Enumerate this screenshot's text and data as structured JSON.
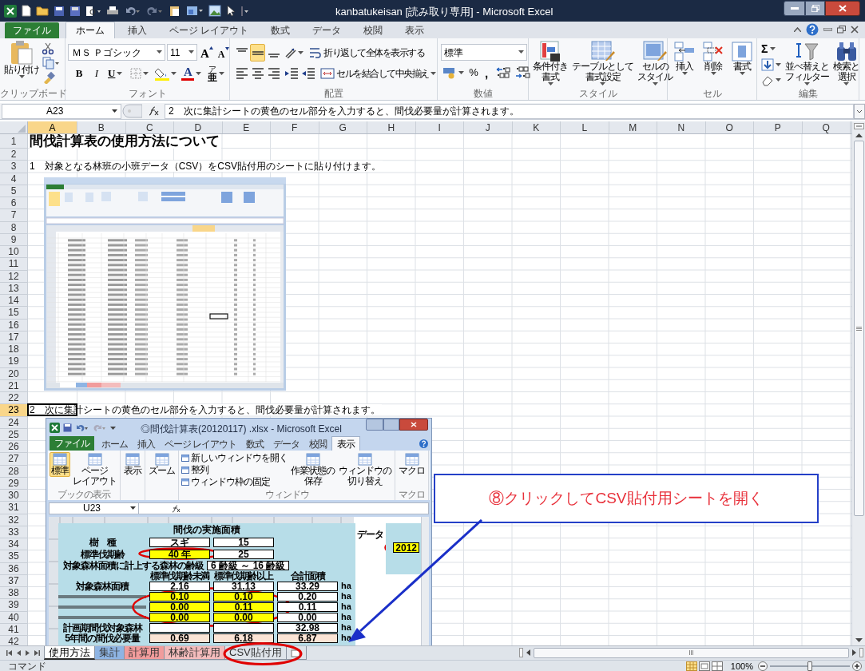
{
  "window": {
    "title": "kanbatukeisan  [読み取り専用] - Microsoft Excel"
  },
  "ribbon_tabs": [
    {
      "label": "ファイル",
      "kind": "file",
      "selected": false
    },
    {
      "label": "ホーム",
      "kind": "tab",
      "selected": true
    },
    {
      "label": "挿入",
      "kind": "tab",
      "selected": false
    },
    {
      "label": "ページ レイアウト",
      "kind": "tab",
      "selected": false
    },
    {
      "label": "数式",
      "kind": "tab",
      "selected": false
    },
    {
      "label": "データ",
      "kind": "tab",
      "selected": false
    },
    {
      "label": "校閲",
      "kind": "tab",
      "selected": false
    },
    {
      "label": "表示",
      "kind": "tab",
      "selected": false
    }
  ],
  "ribbon": {
    "clipboard": {
      "paste": "貼り付け",
      "label": "クリップボード"
    },
    "font": {
      "name": "ＭＳ Ｐゴシック",
      "size": "11",
      "grow": "A",
      "shrink": "A",
      "bold": "B",
      "italic": "I",
      "underline": "U",
      "font_color": "A",
      "phonetic_ruby": "ア",
      "phonetic": "亜",
      "label": "フォント"
    },
    "alignment": {
      "vertical": [
        {
          "selected": false
        },
        {
          "selected": true
        },
        {
          "selected": false
        }
      ],
      "wrap": "折り返して全体を表示する",
      "merge": "セルを結合して中央揃え",
      "label": "配置"
    },
    "number": {
      "format": "標準",
      "percent": "%",
      "comma": ",",
      "label": "数値"
    },
    "styles": {
      "items": [
        {
          "lines": [
            "条件付き",
            "書式"
          ]
        },
        {
          "lines": [
            "テーブルとして",
            "書式設定"
          ]
        },
        {
          "lines": [
            "セルの",
            "スタイル"
          ]
        }
      ],
      "label": "スタイル"
    },
    "cells": {
      "items": [
        "挿入",
        "削除",
        "書式"
      ],
      "label": "セル"
    },
    "editing": {
      "sum": "Σ",
      "items": [
        {
          "lines": [
            "並べ替えと",
            "フィルター"
          ]
        },
        {
          "lines": [
            "検索と",
            "選択"
          ]
        }
      ],
      "label": "編集"
    }
  },
  "formula_bar": {
    "name_box": "A23",
    "formula": "2　次に集計シートの黄色のセル部分を入力すると、間伐必要量が計算されます。"
  },
  "columns": [
    {
      "label": "A",
      "selected": true
    },
    {
      "label": "B",
      "selected": false
    },
    {
      "label": "C",
      "selected": false
    },
    {
      "label": "D",
      "selected": false
    },
    {
      "label": "E",
      "selected": false
    },
    {
      "label": "F",
      "selected": false
    },
    {
      "label": "G",
      "selected": false
    },
    {
      "label": "H",
      "selected": false
    },
    {
      "label": "I",
      "selected": false
    },
    {
      "label": "J",
      "selected": false
    },
    {
      "label": "K",
      "selected": false
    },
    {
      "label": "L",
      "selected": false
    },
    {
      "label": "M",
      "selected": false
    },
    {
      "label": "N",
      "selected": false
    },
    {
      "label": "O",
      "selected": false
    },
    {
      "label": "P",
      "selected": false
    },
    {
      "label": "Q",
      "selected": false
    }
  ],
  "rows": [
    {
      "number": "1",
      "kind": "title",
      "text": "間伐計算表の使用方法について",
      "selected": false
    },
    {
      "number": "2",
      "selected": false
    },
    {
      "number": "3",
      "kind": "text",
      "text": "1　対象となる林班の小班データ（CSV）をCSV貼付用のシートに貼り付けます。",
      "selected": false
    },
    {
      "number": "4",
      "selected": false
    },
    {
      "number": "5",
      "selected": false
    },
    {
      "number": "6",
      "selected": false
    },
    {
      "number": "7",
      "selected": false
    },
    {
      "number": "8",
      "selected": false
    },
    {
      "number": "9",
      "selected": false
    },
    {
      "number": "10",
      "selected": false
    },
    {
      "number": "11",
      "selected": false
    },
    {
      "number": "12",
      "selected": false
    },
    {
      "number": "13",
      "selected": false
    },
    {
      "number": "14",
      "selected": false
    },
    {
      "number": "15",
      "selected": false
    },
    {
      "number": "16",
      "selected": false
    },
    {
      "number": "17",
      "selected": false
    },
    {
      "number": "18",
      "selected": false
    },
    {
      "number": "19",
      "selected": false
    },
    {
      "number": "20",
      "selected": false
    },
    {
      "number": "21",
      "selected": false
    },
    {
      "number": "22",
      "selected": false
    },
    {
      "number": "23",
      "kind": "text",
      "text": "2　次に集計シートの黄色のセル部分を入力すると、間伐必要量が計算されます。",
      "selected": true
    },
    {
      "number": "24",
      "selected": false
    },
    {
      "number": "25",
      "selected": false
    },
    {
      "number": "26",
      "selected": false
    },
    {
      "number": "27",
      "selected": false
    },
    {
      "number": "28",
      "selected": false
    },
    {
      "number": "29",
      "selected": false
    },
    {
      "number": "30",
      "selected": false
    },
    {
      "number": "31",
      "selected": false
    },
    {
      "number": "32",
      "selected": false
    },
    {
      "number": "33",
      "selected": false
    },
    {
      "number": "34",
      "selected": false
    },
    {
      "number": "35",
      "selected": false
    },
    {
      "number": "36",
      "selected": false
    },
    {
      "number": "37",
      "selected": false
    },
    {
      "number": "38",
      "selected": false
    },
    {
      "number": "39",
      "selected": false
    },
    {
      "number": "40",
      "selected": false
    },
    {
      "number": "41",
      "selected": false
    },
    {
      "number": "42",
      "selected": false
    }
  ],
  "embedded_window": {
    "title": "◎間伐計算表(20120117) .xlsx - Microsoft Excel",
    "tabs": [
      {
        "label": "ファイル",
        "kind": "file",
        "selected": false
      },
      {
        "label": "ホーム",
        "kind": "tab",
        "selected": false
      },
      {
        "label": "挿入",
        "kind": "tab",
        "selected": false
      },
      {
        "label": "ページ レイアウト",
        "kind": "tab",
        "selected": false
      },
      {
        "label": "数式",
        "kind": "tab",
        "selected": false
      },
      {
        "label": "データ",
        "kind": "tab",
        "selected": false
      },
      {
        "label": "校閲",
        "kind": "tab",
        "selected": false
      },
      {
        "label": "表示",
        "kind": "tab",
        "selected": true
      }
    ],
    "groups": [
      {
        "label": "ブックの表示",
        "items": [
          {
            "lines": [
              "標準"
            ],
            "kind": "big",
            "selected": true
          },
          {
            "lines": [
              "ページ",
              "レイアウト"
            ],
            "kind": "big",
            "selected": false
          }
        ]
      },
      {
        "items": [
          {
            "lines": [
              "表示"
            ],
            "kind": "big",
            "selected": false
          }
        ]
      },
      {
        "items": [
          {
            "lines": [
              "ズーム"
            ],
            "kind": "big",
            "selected": false
          }
        ]
      },
      {
        "label": "ウィンドウ",
        "items": [
          {
            "lines": [
              "新しいウィンドウを開く"
            ],
            "kind": "small",
            "selected": false
          },
          {
            "lines": [
              "整列"
            ],
            "kind": "small",
            "selected": false
          },
          {
            "lines": [
              "ウィンドウ枠の固定"
            ],
            "kind": "small",
            "selected": false
          },
          {
            "lines": [
              "作業状態の",
              "保存"
            ],
            "kind": "big",
            "selected": false
          },
          {
            "lines": [
              "ウィンドウの",
              "切り替え"
            ],
            "kind": "big",
            "selected": false
          }
        ]
      },
      {
        "label": "マクロ",
        "items": [
          {
            "lines": [
              "マクロ"
            ],
            "kind": "big",
            "selected": false
          }
        ]
      }
    ],
    "name_box": "U23",
    "sheet": {
      "title": "間伐の実施面積",
      "top_rows": [
        {
          "label": "樹　種",
          "cells": [
            {
              "text": "スギ",
              "kind": "plain"
            },
            {
              "text": "15",
              "kind": "plain"
            }
          ]
        },
        {
          "label": "標準伐期齢",
          "cells": [
            {
              "text": "40 年",
              "kind": "input"
            },
            {
              "text": "25",
              "kind": "plain"
            }
          ]
        }
      ],
      "age_class": {
        "label": "対象森林面積に計上する森林の齢級",
        "value": "6 齢級 ～ 16 齢級"
      },
      "column_headers": [
        "標準伐期齢未満",
        "標準伐期齢以上",
        "合計面積"
      ],
      "rows": [
        {
          "label": "対象森林面積",
          "cells": [
            {
              "text": "2.16",
              "kind": "plain"
            },
            {
              "text": "31.13",
              "kind": "plain"
            },
            {
              "text": "33.29",
              "kind": "plain"
            }
          ],
          "unit": "ha"
        },
        {
          "cells": [
            {
              "text": "0.10",
              "kind": "input"
            },
            {
              "text": "0.10",
              "kind": "input"
            },
            {
              "text": "0.20",
              "kind": "plain"
            }
          ],
          "unit": "ha"
        },
        {
          "cells": [
            {
              "text": "0.00",
              "kind": "input"
            },
            {
              "text": "0.11",
              "kind": "input"
            },
            {
              "text": "0.11",
              "kind": "plain"
            }
          ],
          "unit": "ha"
        },
        {
          "cells": [
            {
              "text": "0.00",
              "kind": "input"
            },
            {
              "text": "0.00",
              "kind": "input"
            },
            {
              "text": "0.00",
              "kind": "plain"
            }
          ],
          "unit": "ha"
        },
        {
          "label": "計画期間伐対象森林",
          "cells": [
            {
              "kind": "covered"
            },
            {
              "kind": "covered"
            },
            {
              "text": "32.98",
              "kind": "plain"
            }
          ],
          "unit": "ha"
        },
        {
          "label": "5年間の間伐必要量",
          "cells": [
            {
              "text": "0.69",
              "kind": "result"
            },
            {
              "text": "6.18",
              "kind": "result"
            },
            {
              "text": "6.87",
              "kind": "result"
            }
          ],
          "unit": "ha"
        }
      ],
      "side_label": "データ",
      "side_value": "2012"
    }
  },
  "callout": {
    "text": "⑧クリックしてCSV貼付用シートを開く"
  },
  "sheet_tabs": [
    {
      "label": "使用方法",
      "color": "#ffffff",
      "selected": true
    },
    {
      "label": "集計",
      "color": "#8eb4e3",
      "selected": false
    },
    {
      "label": "計算用",
      "color": "#f19c9c",
      "selected": false
    },
    {
      "label": "林齢計算用",
      "color": "#f4bcbc",
      "selected": false
    },
    {
      "label": "CSV貼付用",
      "color": "#dfe4ea",
      "selected": false
    }
  ],
  "status_bar": {
    "mode": "コマンド",
    "zoom": "100%",
    "zoom_slider": {
      "level": 0.5
    }
  }
}
